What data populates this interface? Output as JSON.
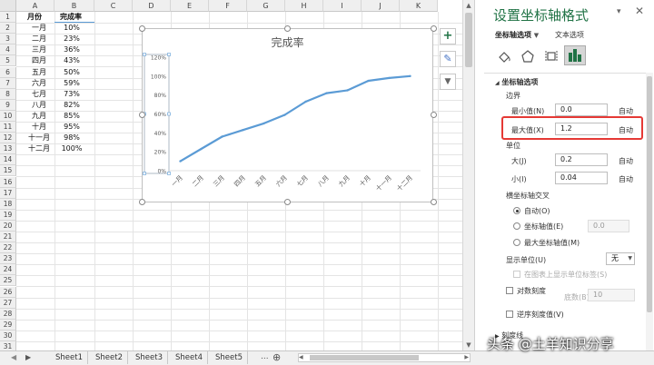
{
  "columns": [
    "A",
    "B",
    "C",
    "D",
    "E",
    "F",
    "G",
    "H",
    "I",
    "J",
    "K"
  ],
  "rows": [
    "1",
    "2",
    "3",
    "4",
    "5",
    "6",
    "7",
    "8",
    "9",
    "10",
    "11",
    "12",
    "13",
    "14",
    "15",
    "16",
    "17",
    "18",
    "19",
    "20",
    "21",
    "22",
    "23",
    "24",
    "25",
    "26",
    "27",
    "28",
    "29",
    "30",
    "31"
  ],
  "table": {
    "header": [
      "月份",
      "完成率"
    ],
    "rows": [
      [
        "一月",
        "10%"
      ],
      [
        "二月",
        "23%"
      ],
      [
        "三月",
        "36%"
      ],
      [
        "四月",
        "43%"
      ],
      [
        "五月",
        "50%"
      ],
      [
        "六月",
        "59%"
      ],
      [
        "七月",
        "73%"
      ],
      [
        "八月",
        "82%"
      ],
      [
        "九月",
        "85%"
      ],
      [
        "十月",
        "95%"
      ],
      [
        "十一月",
        "98%"
      ],
      [
        "十二月",
        "100%"
      ]
    ]
  },
  "chart_data": {
    "type": "line",
    "title": "完成率",
    "categories": [
      "一月",
      "二月",
      "三月",
      "四月",
      "五月",
      "六月",
      "七月",
      "八月",
      "九月",
      "十月",
      "十一月",
      "十二月"
    ],
    "values": [
      0.1,
      0.23,
      0.36,
      0.43,
      0.5,
      0.59,
      0.73,
      0.82,
      0.85,
      0.95,
      0.98,
      1.0
    ],
    "y_ticks": [
      "0%",
      "20%",
      "40%",
      "60%",
      "80%",
      "100%",
      "120%"
    ],
    "ylim": [
      0,
      1.2
    ],
    "line_color": "#5b9bd5",
    "grid": false
  },
  "chart_buttons": {
    "add": "+",
    "style": "✎",
    "filter": "▼"
  },
  "sheet_tabs": [
    "Sheet1",
    "Sheet2",
    "Sheet3",
    "Sheet4",
    "Sheet5"
  ],
  "tab_more": "...",
  "tab_add": "⊕",
  "panel": {
    "title": "设置坐标轴格式",
    "tab_axis": "坐标轴选项",
    "tab_text": "文本选项",
    "section": "坐标轴选项",
    "bounds_label": "边界",
    "min_label": "最小值(N)",
    "min_value": "0.0",
    "min_auto": "自动",
    "max_label": "最大值(X)",
    "max_value": "1.2",
    "max_auto": "自动",
    "units_label": "单位",
    "major_label": "大(J)",
    "major_value": "0.2",
    "major_auto": "自动",
    "minor_label": "小(I)",
    "minor_value": "0.04",
    "minor_auto": "自动",
    "cross_label": "横坐标轴交叉",
    "cross_auto": "自动(O)",
    "cross_value": "坐标轴值(E)",
    "cross_value_input": "0.0",
    "cross_max": "最大坐标轴值(M)",
    "display_units": "显示单位(U)",
    "display_units_value": "无",
    "show_units_label": "在图表上显示单位标签(S)",
    "log_scale": "对数刻度",
    "log_base_label": "底数(B)",
    "log_base_value": "10",
    "reverse": "逆序刻度值(V)",
    "tick_marks": "刻度线"
  },
  "watermark": "头条 @土羊知识分享"
}
